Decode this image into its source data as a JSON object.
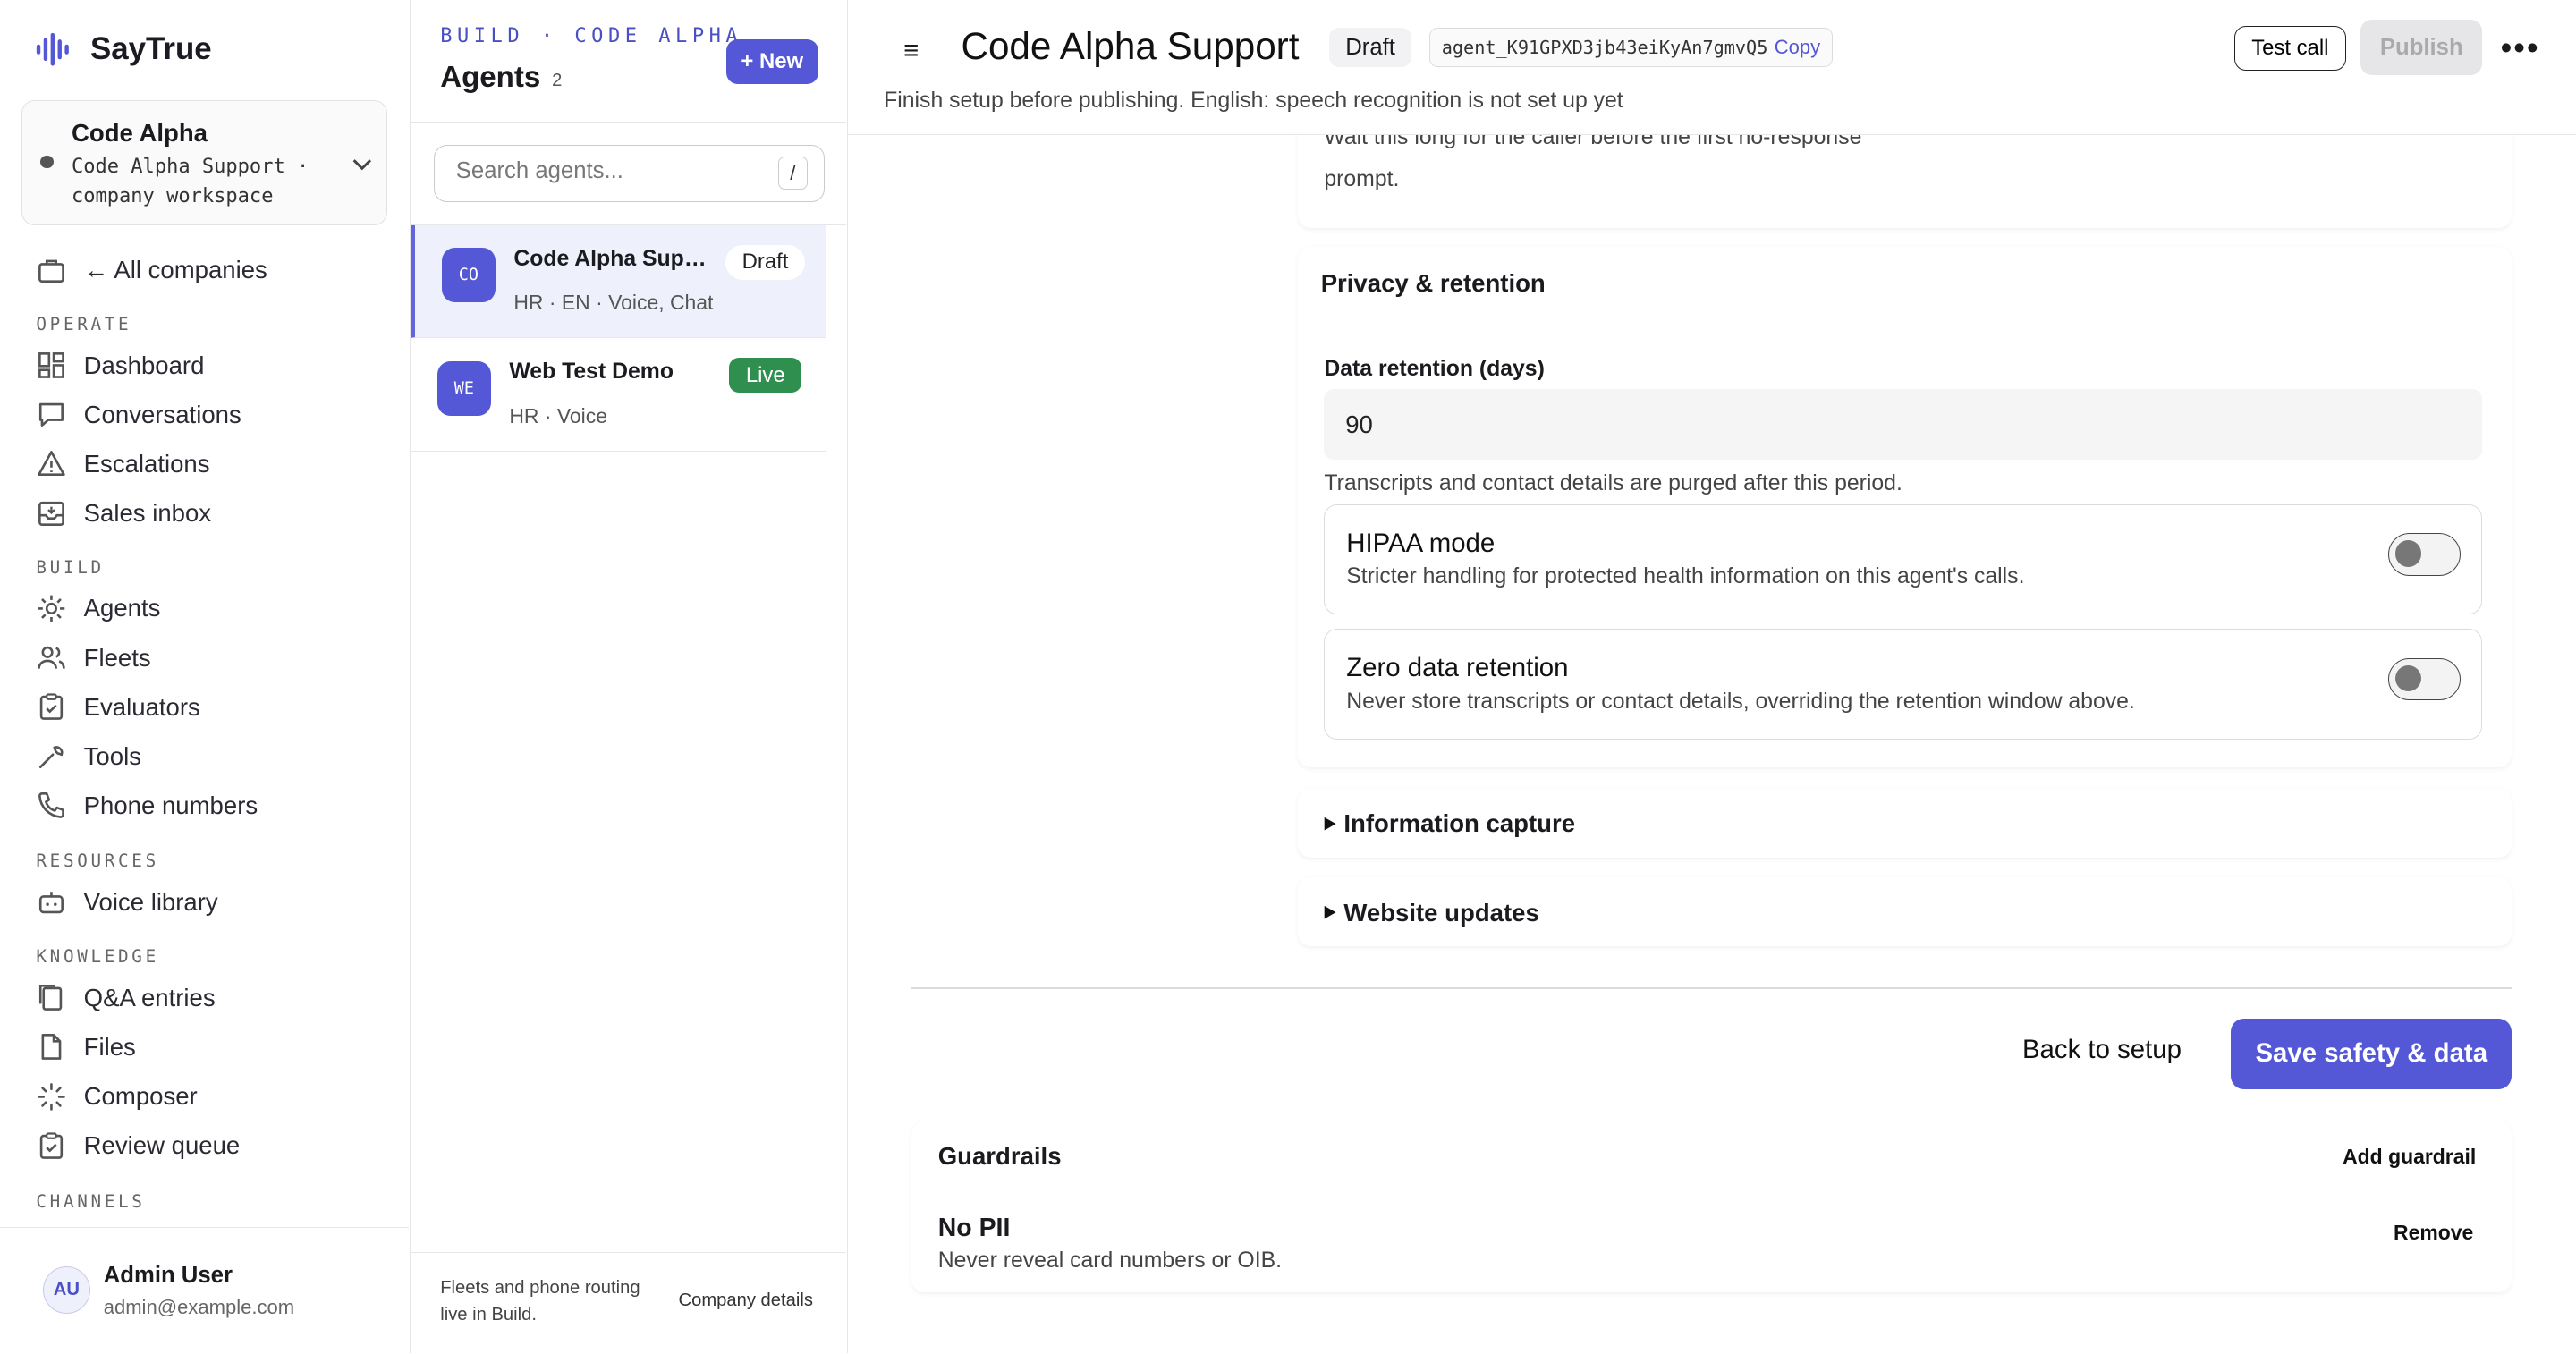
{
  "app": {
    "name": "SayTrue"
  },
  "workspace": {
    "name": "Code Alpha",
    "subtitle": "Code Alpha Support · company workspace"
  },
  "sidebar": {
    "back_link": "← All companies",
    "sections": {
      "operate": "OPERATE",
      "build": "BUILD",
      "resources": "RESOURCES",
      "knowledge": "KNOWLEDGE",
      "channels": "CHANNELS"
    },
    "items": {
      "dashboard": "Dashboard",
      "conversations": "Conversations",
      "escalations": "Escalations",
      "sales_inbox": "Sales inbox",
      "agents": "Agents",
      "fleets": "Fleets",
      "evaluators": "Evaluators",
      "tools": "Tools",
      "phone_numbers": "Phone numbers",
      "voice_library": "Voice library",
      "qa_entries": "Q&A entries",
      "files": "Files",
      "composer": "Composer",
      "review_queue": "Review queue"
    },
    "user": {
      "initials": "AU",
      "name": "Admin User",
      "email": "admin@example.com"
    }
  },
  "agent_list": {
    "kicker": "BUILD · CODE ALPHA",
    "title": "Agents",
    "count": "2",
    "new_button": "+ New",
    "search_placeholder": "Search agents...",
    "search_shortcut": "/",
    "agents": [
      {
        "initials": "CO",
        "name": "Code Alpha Support",
        "meta": "HR · EN · Voice, Chat",
        "status": "Draft"
      },
      {
        "initials": "WE",
        "name": "Web Test Demo",
        "meta": "HR · Voice",
        "status": "Live"
      }
    ],
    "footer_note": "Fleets and phone routing live in Build.",
    "footer_link": "Company details"
  },
  "header": {
    "title": "Code Alpha Support",
    "status": "Draft",
    "agent_id": "agent_K91GPXD3jb43eiKyAn7gmvQ5",
    "copy_label": "Copy",
    "test_call": "Test call",
    "publish": "Publish",
    "more": "•••",
    "menu_icon": "≡",
    "notice": "Finish setup before publishing. English: speech recognition is not set up yet"
  },
  "fragment": {
    "line1": "Wait this long for the caller before the first no-response",
    "line2": "prompt."
  },
  "privacy": {
    "title": "Privacy & retention",
    "retention_label": "Data retention (days)",
    "retention_value": "90",
    "retention_help": "Transcripts and contact details are purged after this period.",
    "toggles": [
      {
        "title": "HIPAA mode",
        "desc": "Stricter handling for protected health information on this agent's calls.",
        "on": false
      },
      {
        "title": "Zero data retention",
        "desc": "Never store transcripts or contact details, overriding the retention window above.",
        "on": false
      }
    ]
  },
  "sections": {
    "info_capture": "Information capture",
    "website_updates": "Website updates"
  },
  "actions": {
    "back": "Back to setup",
    "save": "Save safety & data"
  },
  "guardrails": {
    "title": "Guardrails",
    "add": "Add guardrail",
    "items": [
      {
        "name": "No PII",
        "desc": "Never reveal card numbers or OIB.",
        "remove": "Remove"
      }
    ]
  },
  "colors": {
    "accent": "#5558d6",
    "live": "#2f8f4e",
    "selected_bg": "#eef0fb"
  }
}
